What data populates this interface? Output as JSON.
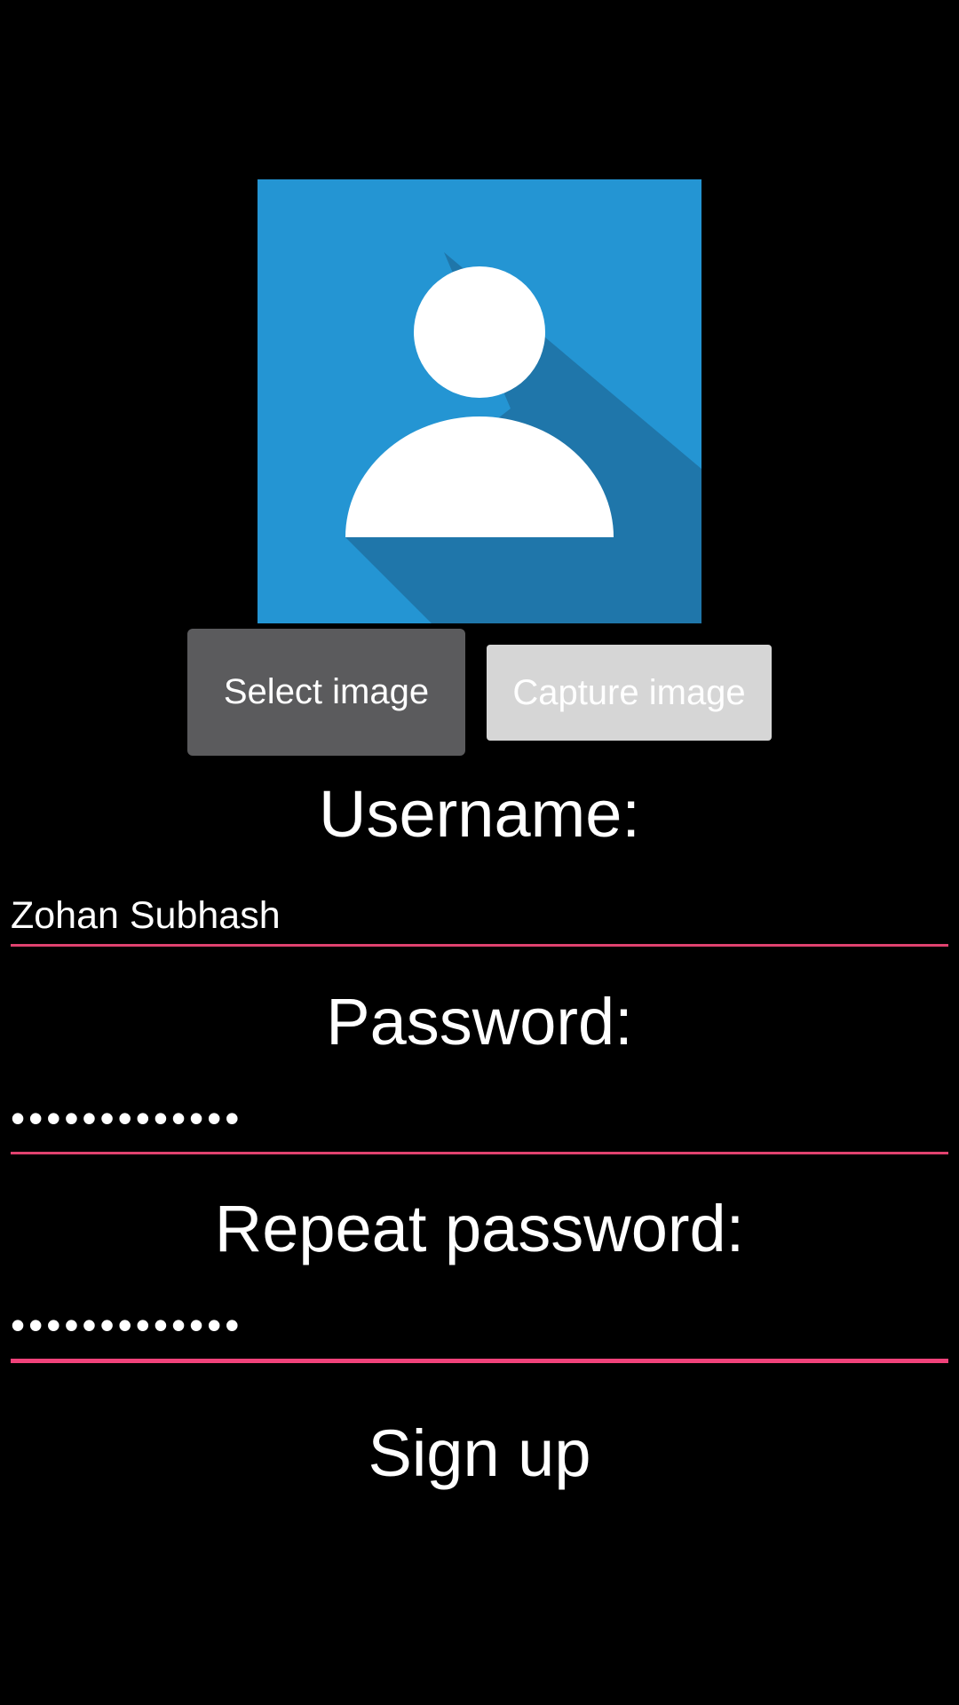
{
  "colors": {
    "background": "#000000",
    "avatar_bg": "#2495d3",
    "avatar_shadow": "#1f76aa",
    "select_button_bg": "#5b5b5d",
    "capture_button_bg": "#d6d6d6",
    "underline_accent": "#e0426f"
  },
  "avatar": {
    "icon": "person-avatar-icon"
  },
  "buttons": {
    "select_image": "Select image",
    "capture_image": "Capture image"
  },
  "form": {
    "username_label": "Username:",
    "username_value": "Zohan Subhash",
    "password_label": "Password:",
    "password_value": "•••••••••••••",
    "repeat_password_label": "Repeat password:",
    "repeat_password_value": "•••••••••••••"
  },
  "signup_label": "Sign up"
}
